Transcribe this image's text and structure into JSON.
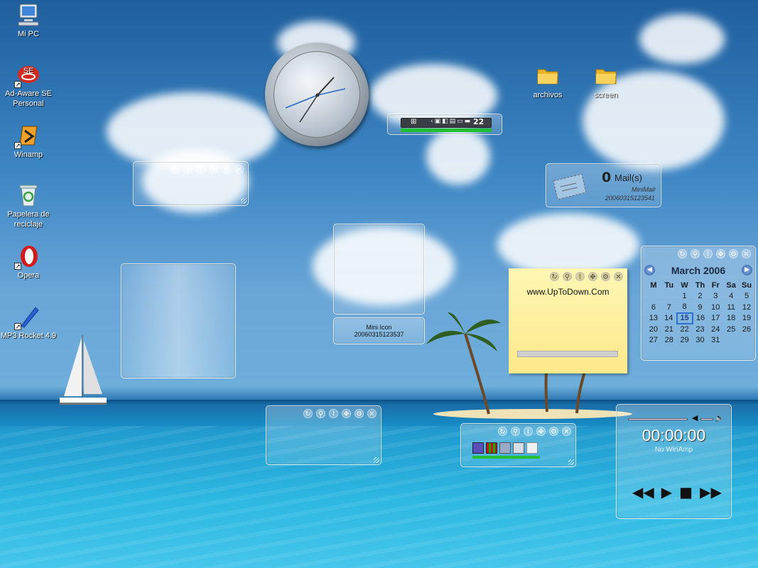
{
  "desktop_icons": [
    {
      "label": "Mi PC",
      "icon": "computer-icon"
    },
    {
      "label": "Ad-Aware SE Personal",
      "icon": "adaware-icon"
    },
    {
      "label": "Winamp",
      "icon": "winamp-icon"
    },
    {
      "label": "Papelera de reciclaje",
      "icon": "recycle-bin-icon"
    },
    {
      "label": "Opera",
      "icon": "opera-icon"
    },
    {
      "label": "MP3 Rocket 4.9",
      "icon": "mp3rocket-icon"
    },
    {
      "label": "archivos",
      "icon": "folder-icon"
    },
    {
      "label": "screen",
      "icon": "folder-icon"
    }
  ],
  "system_bar": {
    "value": "22"
  },
  "mail_widget": {
    "count": "0",
    "label": "Mail(s)",
    "name": "MiniMail",
    "id": "20060315123541"
  },
  "mini_icon_widget": {
    "name": "Mini Icon",
    "id": "20060315123537"
  },
  "calendar": {
    "month_title": "March 2006",
    "weekdays": [
      "M",
      "Tu",
      "W",
      "Th",
      "Fr",
      "Sa",
      "Su"
    ],
    "weeks": [
      [
        "",
        "",
        "1",
        "2",
        "3",
        "4",
        "5"
      ],
      [
        "6",
        "7",
        "8",
        "9",
        "10",
        "11",
        "12"
      ],
      [
        "13",
        "14",
        "15",
        "16",
        "17",
        "18",
        "19"
      ],
      [
        "20",
        "21",
        "22",
        "23",
        "24",
        "25",
        "26"
      ],
      [
        "27",
        "28",
        "29",
        "30",
        "31",
        "",
        ""
      ]
    ],
    "today": "15"
  },
  "note": {
    "text": "www.UpToDown.Com"
  },
  "player": {
    "time": "00:00:00",
    "status": "No WinAmp"
  },
  "colors": {
    "calendar_today": "#2f6fd0",
    "note_bg": "#fdf0a0",
    "meter_green": "#22c030"
  }
}
